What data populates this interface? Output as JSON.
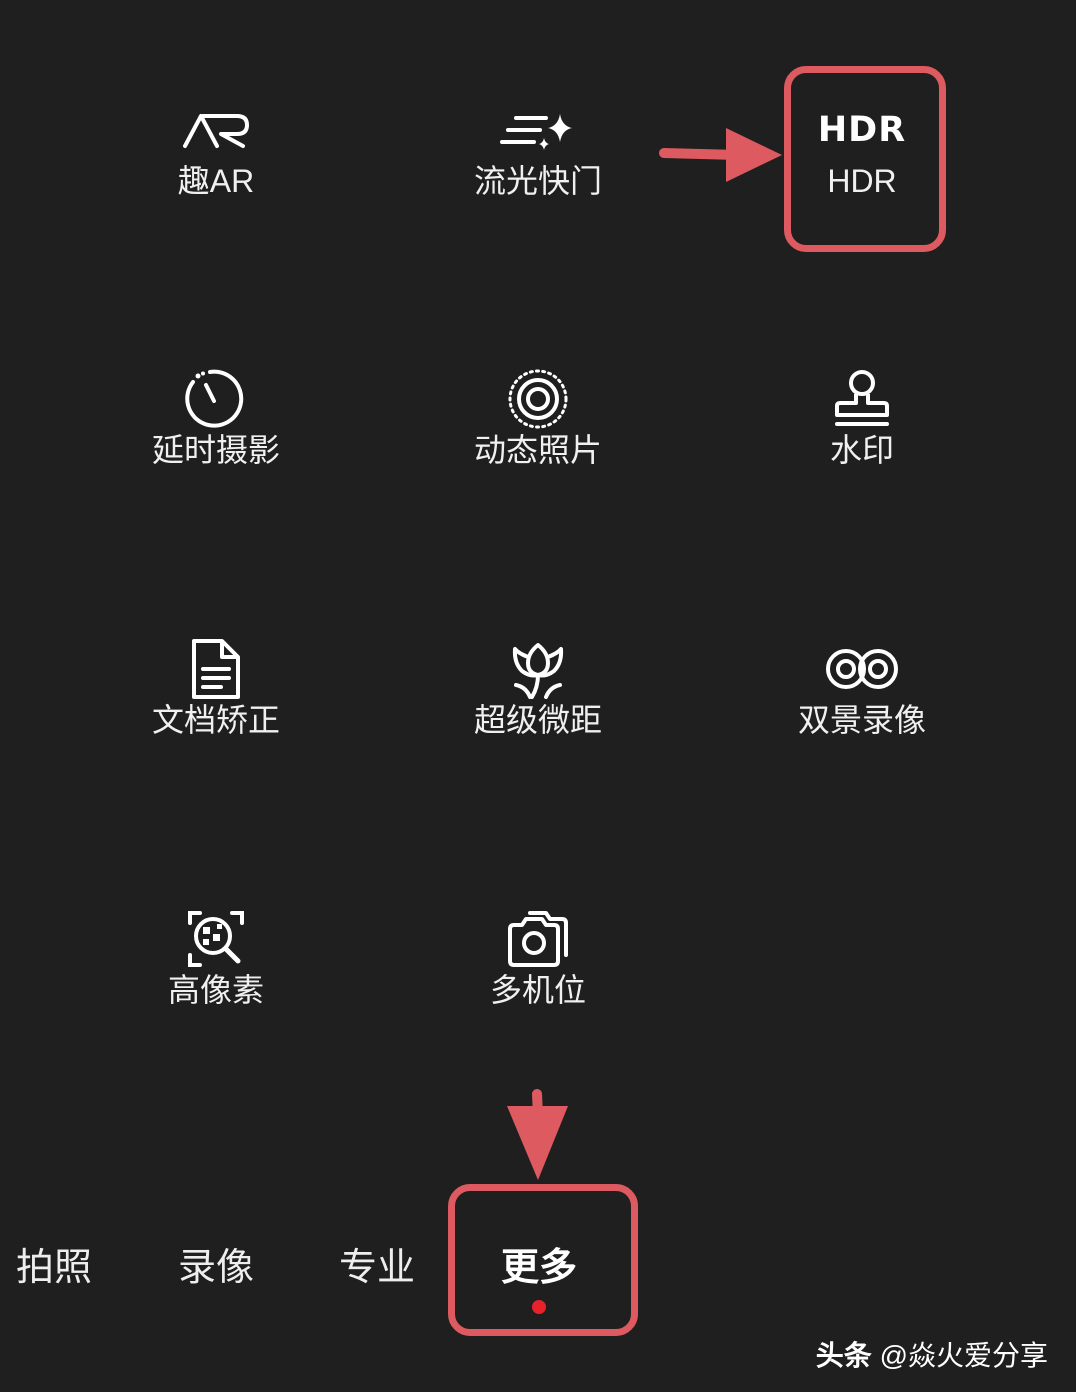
{
  "modes": [
    {
      "id": "ar",
      "label": "趣AR",
      "icon": "ar-icon"
    },
    {
      "id": "light-painting",
      "label": "流光快门",
      "icon": "light-painting-icon"
    },
    {
      "id": "hdr",
      "label": "HDR",
      "icon": "hdr-icon",
      "icon_text": "HDR"
    },
    {
      "id": "time-lapse",
      "label": "延时摄影",
      "icon": "timer-icon"
    },
    {
      "id": "moving-picture",
      "label": "动态照片",
      "icon": "live-photo-icon"
    },
    {
      "id": "watermark",
      "label": "水印",
      "icon": "stamp-icon"
    },
    {
      "id": "document",
      "label": "文档矫正",
      "icon": "document-icon"
    },
    {
      "id": "macro",
      "label": "超级微距",
      "icon": "flower-icon"
    },
    {
      "id": "dual-view",
      "label": "双景录像",
      "icon": "dual-view-icon"
    },
    {
      "id": "high-res",
      "label": "高像素",
      "icon": "high-res-icon"
    },
    {
      "id": "multi-cam",
      "label": "多机位",
      "icon": "multi-camera-icon"
    }
  ],
  "tabs": [
    {
      "id": "photo",
      "label": "拍照",
      "active": false
    },
    {
      "id": "video",
      "label": "录像",
      "active": false
    },
    {
      "id": "pro",
      "label": "专业",
      "active": false
    },
    {
      "id": "more",
      "label": "更多",
      "active": true
    }
  ],
  "watermark": {
    "brand": "头条",
    "handle": "@焱火爱分享"
  },
  "colors": {
    "background": "#1f1f1f",
    "annotation": "#dd5a60",
    "active_dot": "#e8222a",
    "text": "#f0f0f0"
  }
}
